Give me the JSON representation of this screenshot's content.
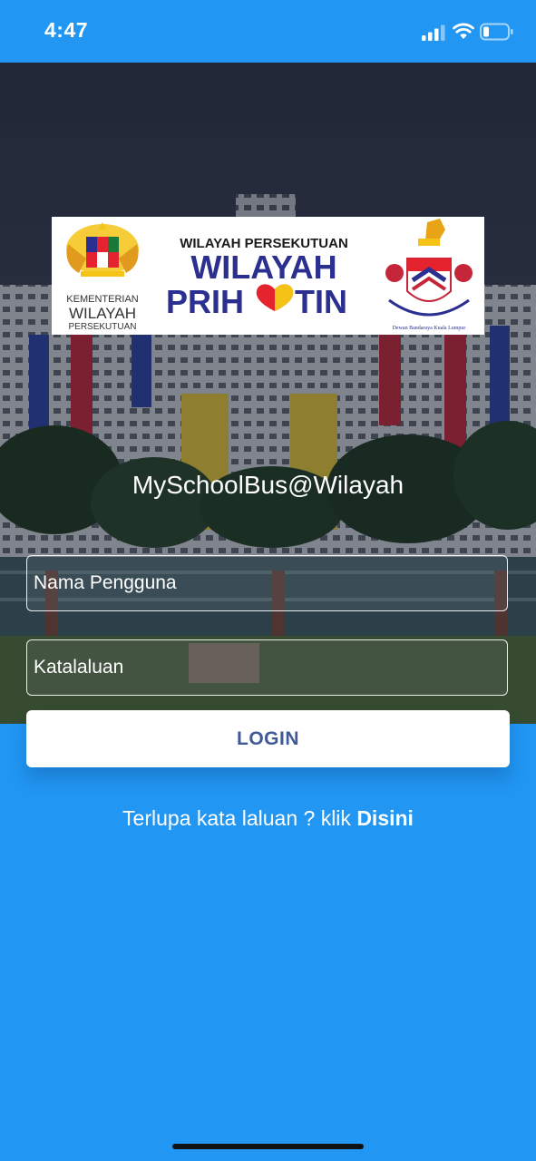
{
  "status_bar": {
    "time": "4:47",
    "icons": [
      "cellular-signal-icon",
      "wifi-icon",
      "battery-icon"
    ]
  },
  "banner": {
    "ministry_line1": "KEMENTERIAN",
    "ministry_line2": "WILAYAH",
    "ministry_line3": "PERSEKUTUAN",
    "headline_top": "WILAYAH PERSEKUTUAN",
    "headline_main": "WILAYAH",
    "headline_pri": "PRIH",
    "headline_tin": "TIN",
    "dbkl_motto": "Dewan Bandaraya Kuala Lumpur"
  },
  "app": {
    "title": "MySchoolBus@Wilayah"
  },
  "form": {
    "username_placeholder": "Nama Pengguna",
    "password_placeholder": "Katalaluan",
    "login_label": "LOGIN"
  },
  "forgot": {
    "text": "Terlupa kata laluan ? klik ",
    "link": "Disini"
  },
  "colors": {
    "primary_blue": "#2196F3",
    "button_text": "#3f5a96",
    "banner_navy": "#2b2f8f",
    "banner_red": "#e5232e",
    "banner_yellow": "#f4c316"
  }
}
